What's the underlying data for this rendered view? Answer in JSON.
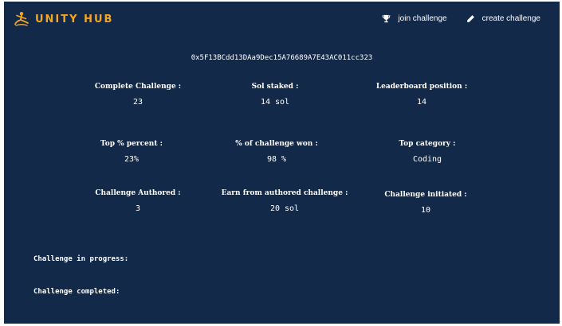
{
  "brand": {
    "name": "UNITY HUB",
    "accent_color": "#f4a623",
    "icon": "yoga-figure-icon"
  },
  "theme": {
    "background": "#12294a",
    "text": "#ffffff"
  },
  "nav": {
    "join": {
      "label": "join challenge",
      "icon": "trophy-icon"
    },
    "create": {
      "label": "create challenge",
      "icon": "pencil-icon"
    }
  },
  "wallet": {
    "address": "0x5F13BCdd13DAa9Dec15A76689A7E43AC011cc323"
  },
  "stats": {
    "complete_challenge": {
      "label": "Complete Challenge :",
      "value": "23"
    },
    "sol_staked": {
      "label": "Sol staked :",
      "value": "14 sol"
    },
    "leaderboard_position": {
      "label": "Leaderboard position :",
      "value": "14"
    },
    "top_percent": {
      "label": "Top % percent :",
      "value": "23%"
    },
    "challenge_won": {
      "label": "% of challenge won :",
      "value": "98 %"
    },
    "top_category": {
      "label": "Top category  :",
      "value": "Coding"
    },
    "challenge_authored": {
      "label": "Challenge Authored :",
      "value": "3"
    },
    "earn_authored": {
      "label": "Earn from authored challenge :",
      "value": "20 sol"
    },
    "challenge_initiated": {
      "label": "Challenge initiated :",
      "value": "10"
    }
  },
  "sections": {
    "in_progress": "Challenge in progress:",
    "completed": "Challenge completed:"
  }
}
